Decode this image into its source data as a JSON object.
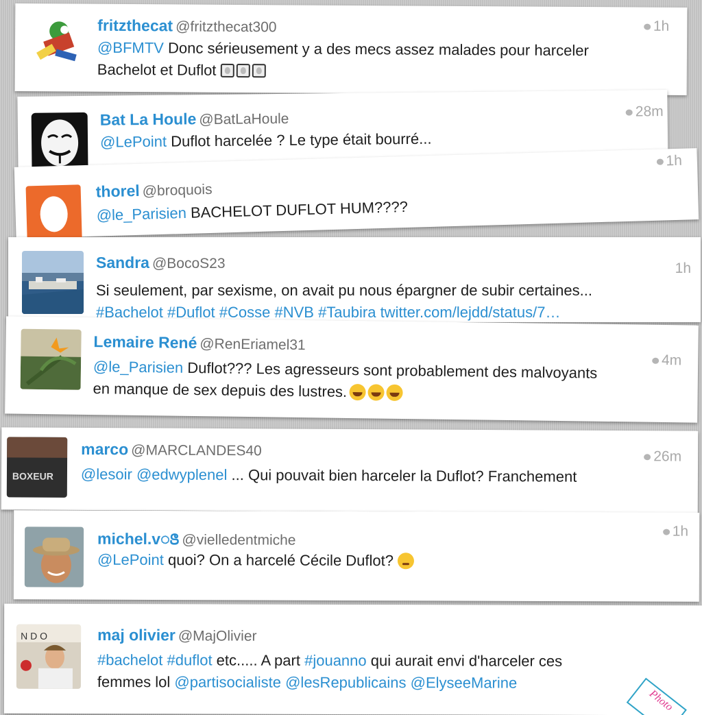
{
  "tweets": [
    {
      "name": "fritzthecat",
      "handle": "@fritzthecat300",
      "time": "1h",
      "line1": "@BFMTV Donc sérieusement y a des mecs assez malades pour harceler",
      "line2": "Bachelot et Duflot"
    },
    {
      "name": "Bat La Houle",
      "handle": "@BatLaHoule",
      "time": "28m",
      "mention": "@LePoint",
      "body": "Duflot harcelée ? Le type était bourré..."
    },
    {
      "name": "thorel",
      "handle": "@broquois",
      "time": "1h",
      "mention": "@le_Parisien",
      "body": "BACHELOT DUFLOT HUM????"
    },
    {
      "name": "Sandra",
      "handle": "@BocoS23",
      "time": "1h",
      "line1": "Si seulement, par sexisme, on avait pu nous épargner de subir certaines...",
      "line2": "#Bachelot #Duflot #Cosse #NVB #Taubira twitter.com/lejdd/status/7…"
    },
    {
      "name": "Lemaire René",
      "handle": "@RenEriamel31",
      "time": "4m",
      "mention": "@le_Parisien",
      "line1": "Duflot??? Les agresseurs sont probablement des malvoyants",
      "line2": "en manque de sex depuis des lustres."
    },
    {
      "name": "marco",
      "handle": "@MARCLANDES40",
      "time": "26m",
      "mention1": "@lesoir",
      "mention2": "@edwyplenel",
      "body": "... Qui pouvait bien harceler la Duflot? Franchement"
    },
    {
      "name": "michel.vꢺ",
      "handle": "@vielledentmiche",
      "time": "1h",
      "mention": "@LePoint",
      "body": "quoi? On a harcelé Cécile Duflot?"
    },
    {
      "name": "maj olivier",
      "handle": "@MajOlivier",
      "tags1": "#bachelot #duflot",
      "mid1": "etc..... A part",
      "tag2": "#jouanno",
      "rest1": "qui aurait envi d'harceler ces",
      "lead2": "femmes lol",
      "mentions2": "@partisocialiste @lesRepublicains @ElyseeMarine",
      "stamp": "Photo"
    }
  ],
  "colors": {
    "link": "#2b8fd1",
    "text": "#1e1e1e",
    "handle": "#6d6d6d",
    "time": "#a9a9a9",
    "card": "#ffffff"
  }
}
